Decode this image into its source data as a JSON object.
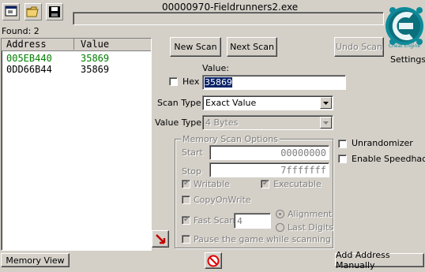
{
  "window": {
    "title": "00000970-Fieldrunners2.exe"
  },
  "found": {
    "label": "Found: 2"
  },
  "results": {
    "headers": [
      "Address",
      "Value"
    ],
    "rows": [
      {
        "address": "005EB440",
        "value": "35869",
        "color": "#008000"
      },
      {
        "address": "0DD66B44",
        "value": "35869",
        "color": "#000000"
      }
    ]
  },
  "buttons": {
    "new_scan": "New Scan",
    "next_scan": "Next Scan",
    "undo_scan": "Undo Scan",
    "memory_view": "Memory View",
    "add_address": "Add Address Manually"
  },
  "logo": {
    "text": "Cheat Engine",
    "settings": "Settings"
  },
  "value_section": {
    "value_label": "Value:",
    "hex_label": "Hex",
    "value_input": "35869",
    "scan_type_label": "Scan Type",
    "scan_type": "Exact Value",
    "value_type_label": "Value Type",
    "value_type": "4 Bytes"
  },
  "memory_options": {
    "title": "Memory Scan Options",
    "start_label": "Start",
    "start_value": "00000000",
    "stop_label": "Stop",
    "stop_value": "7fffffff",
    "writable": "Writable",
    "executable": "Executable",
    "copy_on_write": "CopyOnWrite",
    "fast_scan": "Fast Scan",
    "fast_scan_value": "4",
    "alignment": "Alignment",
    "last_digits": "Last Digits",
    "pause": "Pause the game while scanning"
  },
  "right_options": {
    "unrandomizer": "Unrandomizer",
    "speedhack": "Enable Speedhack"
  },
  "colors": {
    "bg": "#d4d0c8",
    "accent": "#0a246a",
    "green_row": "#008000"
  },
  "icons": [
    "process-select-icon",
    "open-folder-icon",
    "save-disk-icon",
    "cheat-engine-logo-icon",
    "pointer-arrow-icon",
    "stop-sign-icon"
  ]
}
